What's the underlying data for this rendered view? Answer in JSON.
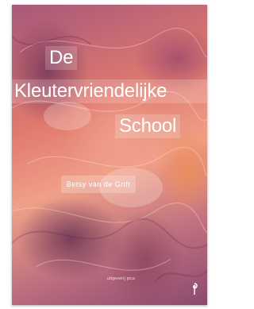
{
  "cover": {
    "title_line_1": "De",
    "title_line_2": "Kleutervriendelijke",
    "title_line_3": "School",
    "author": "Betsy van de Grift",
    "publisher": "uitgeverij pica",
    "logo_icon": "publisher-logo-icon",
    "palette": {
      "coral": "#e07a6f",
      "peach": "#f0a088",
      "mauve": "#a8587a",
      "plum": "#8a4a6e"
    }
  }
}
